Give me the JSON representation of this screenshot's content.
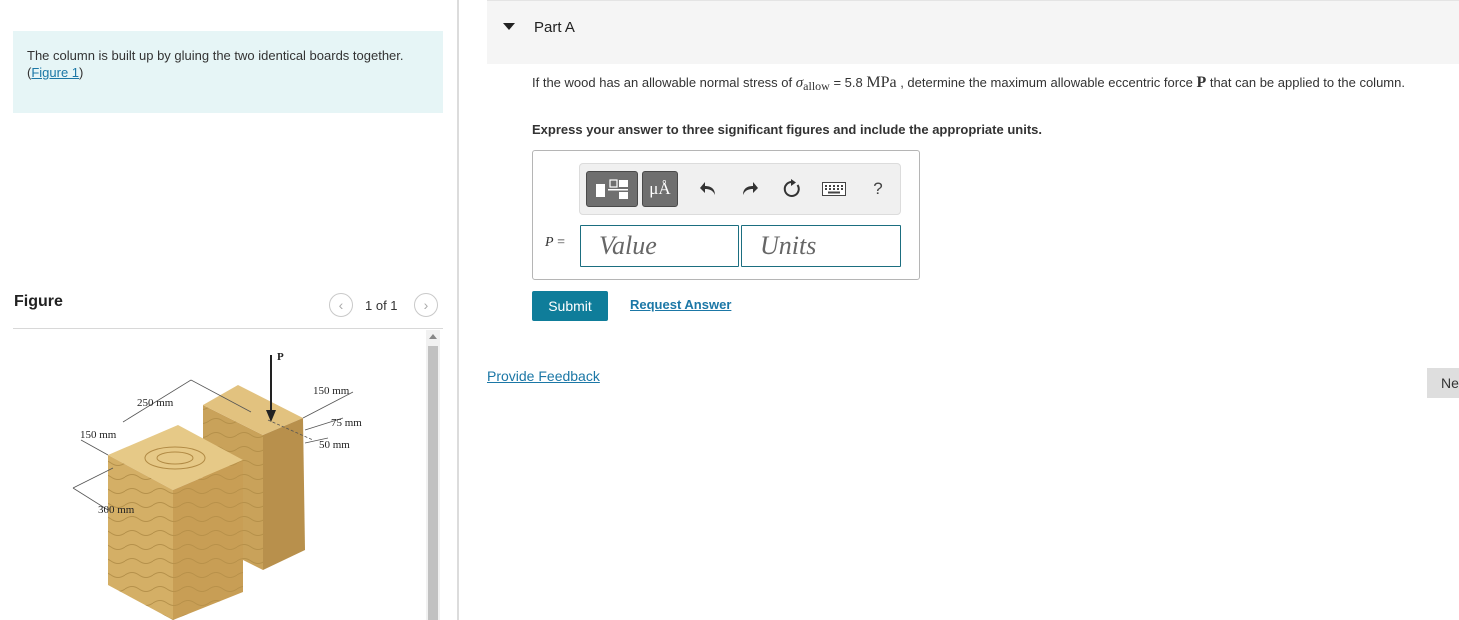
{
  "problem": {
    "text": "The column is built up by gluing the two identical boards together.",
    "figure_link_open": "(",
    "figure_link": "Figure 1",
    "figure_link_close": ")"
  },
  "figure": {
    "title": "Figure",
    "pager_text": "1 of 1",
    "prev_icon": "‹",
    "next_icon": "›",
    "labels": {
      "p": "P",
      "d250": "250 mm",
      "d150_left": "150 mm",
      "d300": "300 mm",
      "d150_right": "150 mm",
      "d75": "75 mm",
      "d50": "50 mm"
    }
  },
  "part": {
    "title": "Part A"
  },
  "question": {
    "prefix": "If the wood has an allowable normal stress of ",
    "sigma": "σ",
    "sub": "allow",
    "eq": " = 5.8 ",
    "unit": "MPa",
    "middle": " , determine the maximum allowable eccentric force ",
    "force": "P",
    "suffix": " that can be applied to the column.",
    "instruction": "Express your answer to three significant figures and include the appropriate units."
  },
  "answer": {
    "label_var": "P",
    "label_eq": " =",
    "value_placeholder": "Value",
    "units_placeholder": "Units"
  },
  "toolbar": {
    "units_label": "μÅ",
    "help_label": "?",
    "icons": [
      "templates-icon",
      "units-icon",
      "undo-icon",
      "redo-icon",
      "reset-icon",
      "keyboard-icon",
      "help-icon"
    ]
  },
  "actions": {
    "submit": "Submit",
    "request_answer": "Request Answer",
    "provide_feedback": "Provide Feedback",
    "next": "Ne"
  },
  "colors": {
    "accent": "#0f7d9a",
    "link": "#1b77a6",
    "problem_bg": "#e6f5f6",
    "wood": "#d9b872"
  }
}
